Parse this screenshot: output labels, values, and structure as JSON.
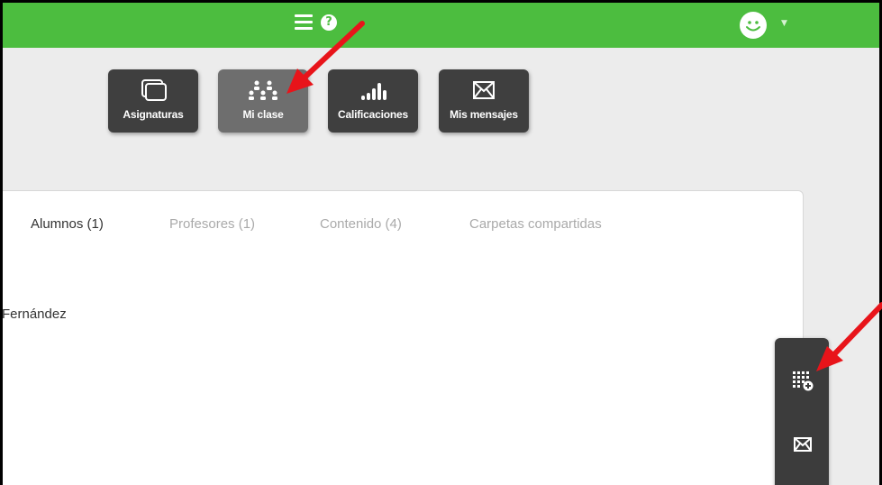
{
  "topbar": {
    "help_glyph": "?"
  },
  "nav": {
    "items": [
      {
        "label": "Asignaturas",
        "icon": "subjects-icon",
        "active": false
      },
      {
        "label": "Mi clase",
        "icon": "class-group-icon",
        "active": true
      },
      {
        "label": "Calificaciones",
        "icon": "grades-chart-icon",
        "active": false
      },
      {
        "label": "Mis mensajes",
        "icon": "envelope-icon",
        "active": false
      }
    ]
  },
  "tabs": [
    {
      "label": "Alumnos (1)",
      "active": true
    },
    {
      "label": "Profesores (1)",
      "active": false
    },
    {
      "label": "Contenido (4)",
      "active": false
    },
    {
      "label": "Carpetas compartidas",
      "active": false
    }
  ],
  "students": [
    {
      "name": "Fernández"
    }
  ],
  "side_panel": {
    "buttons": [
      {
        "icon": "add-grid-icon"
      },
      {
        "icon": "envelope-icon"
      }
    ]
  },
  "colors": {
    "topbar": "#4cbd3f",
    "nav_button": "#3f3f3f",
    "nav_button_active": "#6e6e6e",
    "annotation_arrow": "#e8141a"
  }
}
